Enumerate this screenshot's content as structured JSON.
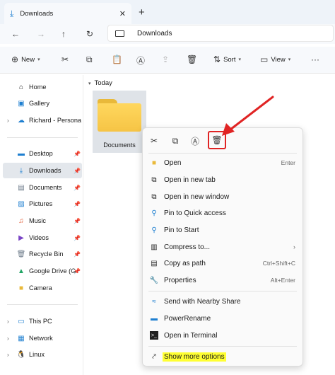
{
  "window": {
    "tab_title": "Downloads",
    "tab_close": "✕",
    "new_tab": "+"
  },
  "address": {
    "crumb": "Downloads"
  },
  "toolbar": {
    "new_label": "New",
    "sort_label": "Sort",
    "view_label": "View",
    "more": "···"
  },
  "sidebar": {
    "items": [
      {
        "label": "Home"
      },
      {
        "label": "Gallery"
      },
      {
        "label": "Richard - Personal"
      },
      {
        "label": "Desktop"
      },
      {
        "label": "Downloads"
      },
      {
        "label": "Documents"
      },
      {
        "label": "Pictures"
      },
      {
        "label": "Music"
      },
      {
        "label": "Videos"
      },
      {
        "label": "Recycle Bin"
      },
      {
        "label": "Google Drive (G"
      },
      {
        "label": "Camera"
      },
      {
        "label": "This PC"
      },
      {
        "label": "Network"
      },
      {
        "label": "Linux"
      }
    ]
  },
  "main": {
    "group_label": "Today",
    "folder_name": "Documents"
  },
  "context_menu": {
    "items": [
      {
        "label": "Open",
        "shortcut": "Enter"
      },
      {
        "label": "Open in new tab",
        "shortcut": ""
      },
      {
        "label": "Open in new window",
        "shortcut": ""
      },
      {
        "label": "Pin to Quick access",
        "shortcut": ""
      },
      {
        "label": "Pin to Start",
        "shortcut": ""
      },
      {
        "label": "Compress to...",
        "shortcut": ""
      },
      {
        "label": "Copy as path",
        "shortcut": "Ctrl+Shift+C"
      },
      {
        "label": "Properties",
        "shortcut": "Alt+Enter"
      },
      {
        "label": "Send with Nearby Share",
        "shortcut": ""
      },
      {
        "label": "PowerRename",
        "shortcut": ""
      },
      {
        "label": "Open in Terminal",
        "shortcut": ""
      },
      {
        "label": "Show more options",
        "shortcut": ""
      }
    ]
  },
  "colors": {
    "accent": "#1e7fd0",
    "highlight_box": "#e02424",
    "text_highlight": "#ffff33",
    "folder": "#f6c445"
  }
}
